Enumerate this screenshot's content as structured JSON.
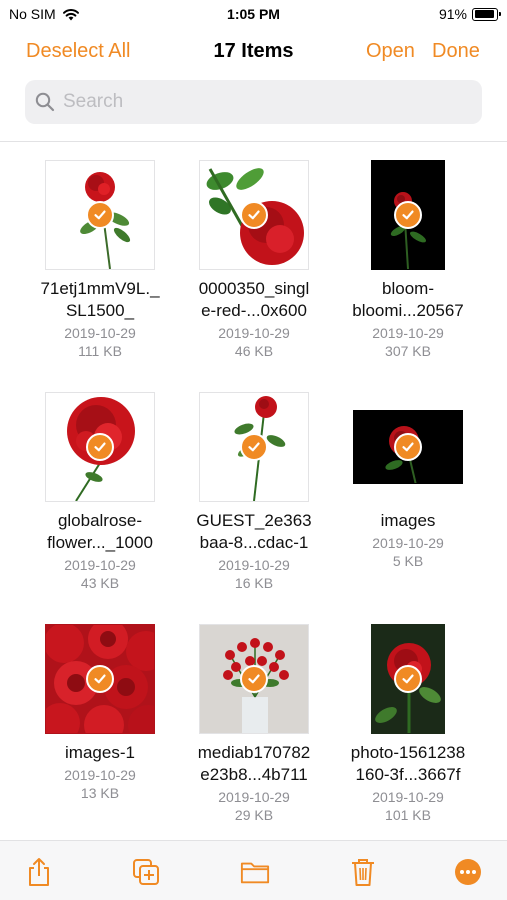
{
  "status": {
    "carrier": "No SIM",
    "time": "1:05 PM",
    "battery": "91%",
    "battery_level": 0.91
  },
  "nav": {
    "deselect_label": "Deselect All",
    "title": "17 Items",
    "open_label": "Open",
    "done_label": "Done"
  },
  "search": {
    "placeholder": "Search",
    "value": ""
  },
  "colors": {
    "accent": "#F08A24",
    "secondary_text": "#8E8E93"
  },
  "files": [
    {
      "name_line1": "71etj1mmV9L._",
      "name_line2": "SL1500_",
      "date": "2019-10-29",
      "size": "111 KB"
    },
    {
      "name_line1": "0000350_singl",
      "name_line2": "e-red-...0x600",
      "date": "2019-10-29",
      "size": "46 KB"
    },
    {
      "name_line1": "bloom-",
      "name_line2": "bloomi...20567",
      "date": "2019-10-29",
      "size": "307 KB"
    },
    {
      "name_line1": "globalrose-",
      "name_line2": "flower..._1000",
      "date": "2019-10-29",
      "size": "43 KB"
    },
    {
      "name_line1": "GUEST_2e363",
      "name_line2": "baa-8...cdac-1",
      "date": "2019-10-29",
      "size": "16 KB"
    },
    {
      "name_line1": "images",
      "name_line2": "",
      "date": "2019-10-29",
      "size": "5 KB"
    },
    {
      "name_line1": "images-1",
      "name_line2": "",
      "date": "2019-10-29",
      "size": "13 KB"
    },
    {
      "name_line1": "mediab170782",
      "name_line2": "e23b8...4b711",
      "date": "2019-10-29",
      "size": "29 KB"
    },
    {
      "name_line1": "photo-1561238",
      "name_line2": "160-3f...3667f",
      "date": "2019-10-29",
      "size": "101 KB"
    }
  ],
  "toolbar": {
    "icons": [
      "share-icon",
      "duplicate-icon",
      "folder-icon",
      "trash-icon",
      "more-icon"
    ]
  }
}
